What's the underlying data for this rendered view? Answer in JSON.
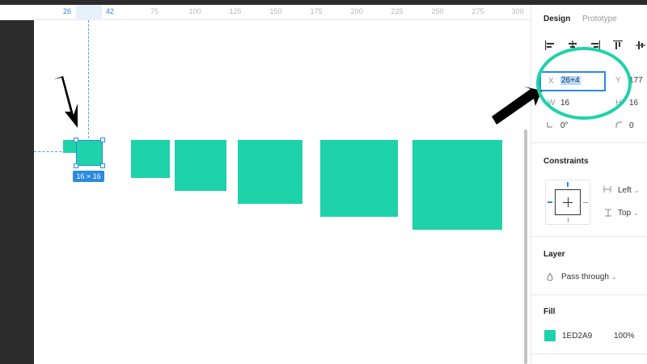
{
  "ruler": {
    "ticks": [
      "26",
      "42",
      "75",
      "100",
      "125",
      "150",
      "175",
      "200",
      "225",
      "250",
      "275",
      "300"
    ]
  },
  "selection": {
    "size_label": "16 × 16"
  },
  "panel": {
    "tabs": {
      "design": "Design",
      "prototype": "Prototype"
    },
    "position": {
      "x_label": "X",
      "x_value": "26+4",
      "y_label": "Y",
      "y_value": "177",
      "w_label": "W",
      "w_value": "16",
      "h_label": "H",
      "h_value": "16",
      "rotation": "0°",
      "corner_radius": "0"
    },
    "constraints": {
      "title": "Constraints",
      "horizontal": "Left",
      "vertical": "Top"
    },
    "layer": {
      "title": "Layer",
      "blend_mode": "Pass through"
    },
    "fill": {
      "title": "Fill",
      "hex": "1ED2A9",
      "opacity": "100%",
      "color": "#1ED2A9"
    }
  },
  "colors": {
    "accent": "#2b8ae0",
    "shape_fill": "#1ED2A9",
    "highlight_ring": "#1ED2A9"
  },
  "icons": {
    "align_left": "align-left-icon",
    "align_center": "align-horizontal-center-icon",
    "align_right": "align-right-icon",
    "align_top": "align-top-icon",
    "align_middle": "align-vertical-center-icon",
    "rotation": "rotation-icon",
    "radius": "corner-radius-icon",
    "blend": "drop-icon"
  }
}
